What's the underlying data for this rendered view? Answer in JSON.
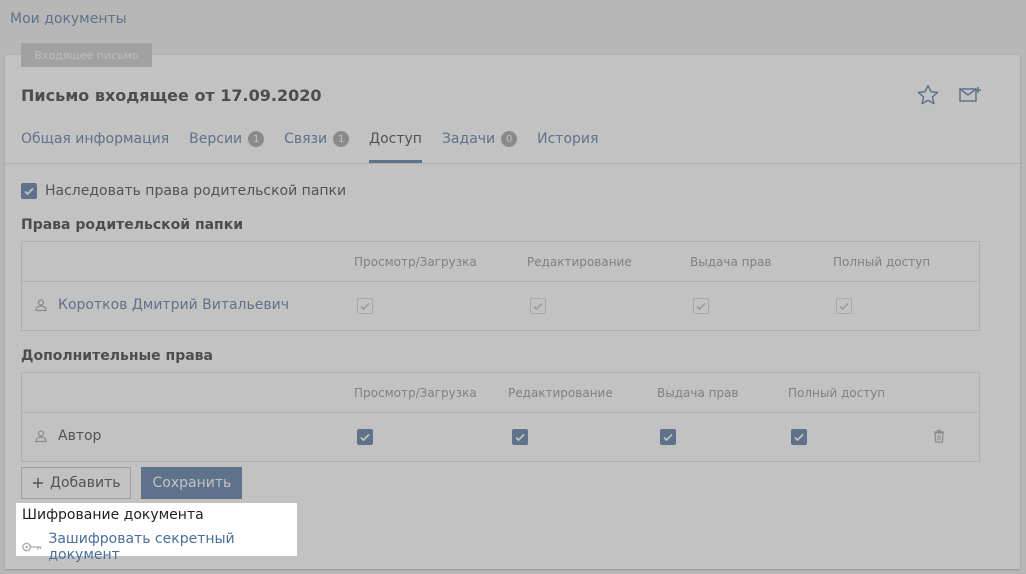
{
  "breadcrumb": "Мои документы",
  "doc_type_badge": "Входящее письмо",
  "doc_title": "Письмо входящее от 17.09.2020",
  "actions": {
    "favorite_icon": "star-icon",
    "mail_icon": "mail-add-icon"
  },
  "tabs": [
    {
      "label": "Общая информация",
      "count": null,
      "active": false
    },
    {
      "label": "Версии",
      "count": "1",
      "active": false
    },
    {
      "label": "Связи",
      "count": "1",
      "active": false
    },
    {
      "label": "Доступ",
      "count": null,
      "active": true
    },
    {
      "label": "Задачи",
      "count": "0",
      "active": false
    },
    {
      "label": "История",
      "count": null,
      "active": false
    }
  ],
  "inherit_checkbox": {
    "label": "Наследовать права родительской папки",
    "checked": true
  },
  "parent_rights": {
    "title": "Права родительской папки",
    "columns": [
      "Просмотр/Загрузка",
      "Редактирование",
      "Выдача прав",
      "Полный доступ"
    ],
    "rows": [
      {
        "user": "Коротков Дмитрий Витальевич",
        "view": true,
        "edit": true,
        "grant": true,
        "full": true
      }
    ]
  },
  "extra_rights": {
    "title": "Дополнительные права",
    "columns": [
      "Просмотр/Загрузка",
      "Редактирование",
      "Выдача прав",
      "Полный доступ"
    ],
    "rows": [
      {
        "user": "Автор",
        "view": true,
        "edit": true,
        "grant": true,
        "full": true
      }
    ]
  },
  "buttons": {
    "add_label": "Добавить",
    "save_label": "Сохранить"
  },
  "encryption": {
    "title": "Шифрование документа",
    "link_label": "Зашифровать секретный документ"
  },
  "colors": {
    "accent": "#4a6e9b",
    "badge": "#9a9a9a"
  }
}
